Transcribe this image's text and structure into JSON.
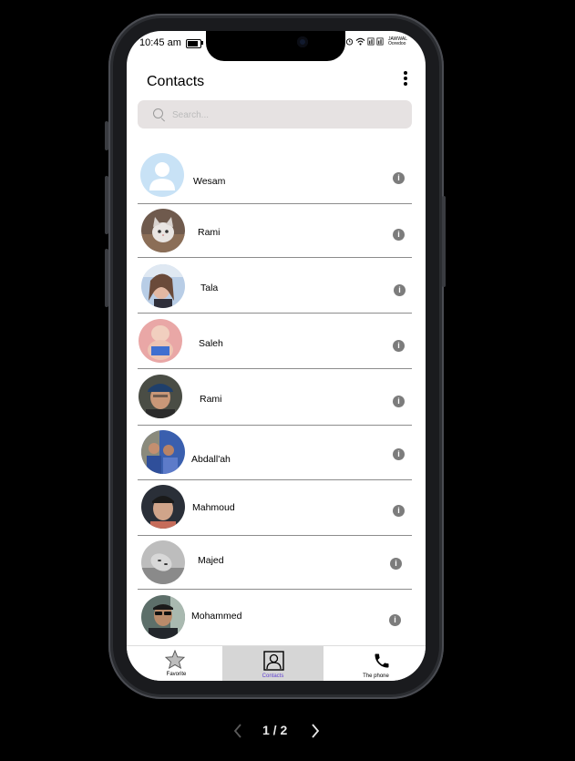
{
  "status_bar": {
    "time": "10:45 am",
    "carrier_line1": "JAWWAL",
    "carrier_line2": "Ooredoo"
  },
  "header": {
    "title": "Contacts"
  },
  "search": {
    "placeholder": "Search..."
  },
  "contacts": [
    {
      "name": "Wesam",
      "avatar": "default-avatar-icon"
    },
    {
      "name": "Rami",
      "avatar": "kitten-photo"
    },
    {
      "name": "Tala",
      "avatar": "selfie-photo"
    },
    {
      "name": "Saleh",
      "avatar": "baby-photo"
    },
    {
      "name": "Rami",
      "avatar": "man-cap-photo"
    },
    {
      "name": "Abdall'ah",
      "avatar": "group-photo"
    },
    {
      "name": "Mahmoud",
      "avatar": "man-photo"
    },
    {
      "name": "Majed",
      "avatar": "bw-photo"
    },
    {
      "name": "Mohammed",
      "avatar": "sunglasses-photo"
    }
  ],
  "tabs": [
    {
      "label": "Favorite",
      "icon": "star-icon"
    },
    {
      "label": "Contacts",
      "icon": "contacts-icon"
    },
    {
      "label": "The phone",
      "icon": "phone-icon"
    }
  ],
  "pager": {
    "label": "1 / 2"
  },
  "colors": {
    "active_tab_bg": "#d6d6d6",
    "active_tab_text": "#5f3fd1",
    "search_bg": "#e6e2e2"
  }
}
